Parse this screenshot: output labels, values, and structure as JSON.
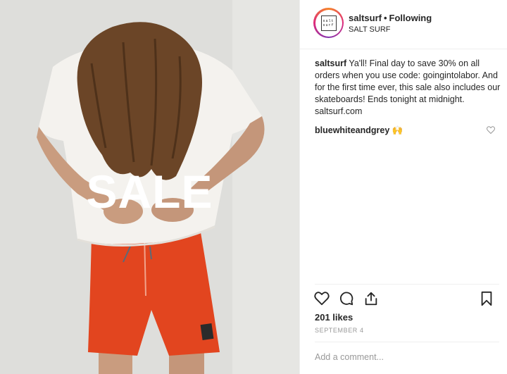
{
  "photo": {
    "overlay_text": "SALE",
    "colors": {
      "shorts": "#e2451f",
      "shirt": "#f4f2ee",
      "hair": "#6b4527",
      "skin": "#c99c7f",
      "wall": "#dededb"
    }
  },
  "header": {
    "username": "saltsurf",
    "separator": "•",
    "follow_status": "Following",
    "location": "SALT SURF",
    "avatar_logo": [
      "salt",
      "surf"
    ]
  },
  "caption": {
    "username": "saltsurf",
    "text": "Ya'll! Final day to save 30% on all orders when you use code: goingintolabor. And for the first time ever, this sale also includes our skateboards! Ends tonight at midnight.",
    "link": "saltsurf.com"
  },
  "comments": [
    {
      "username": "bluewhiteandgrey",
      "emoji": "🙌",
      "like_icon": "heart-outline-icon"
    }
  ],
  "actions": {
    "icons": [
      "heart-icon",
      "comment-icon",
      "share-icon",
      "bookmark-icon"
    ]
  },
  "likes": "201 likes",
  "date": "SEPTEMBER 4",
  "comment_input": {
    "placeholder": "Add a comment..."
  }
}
